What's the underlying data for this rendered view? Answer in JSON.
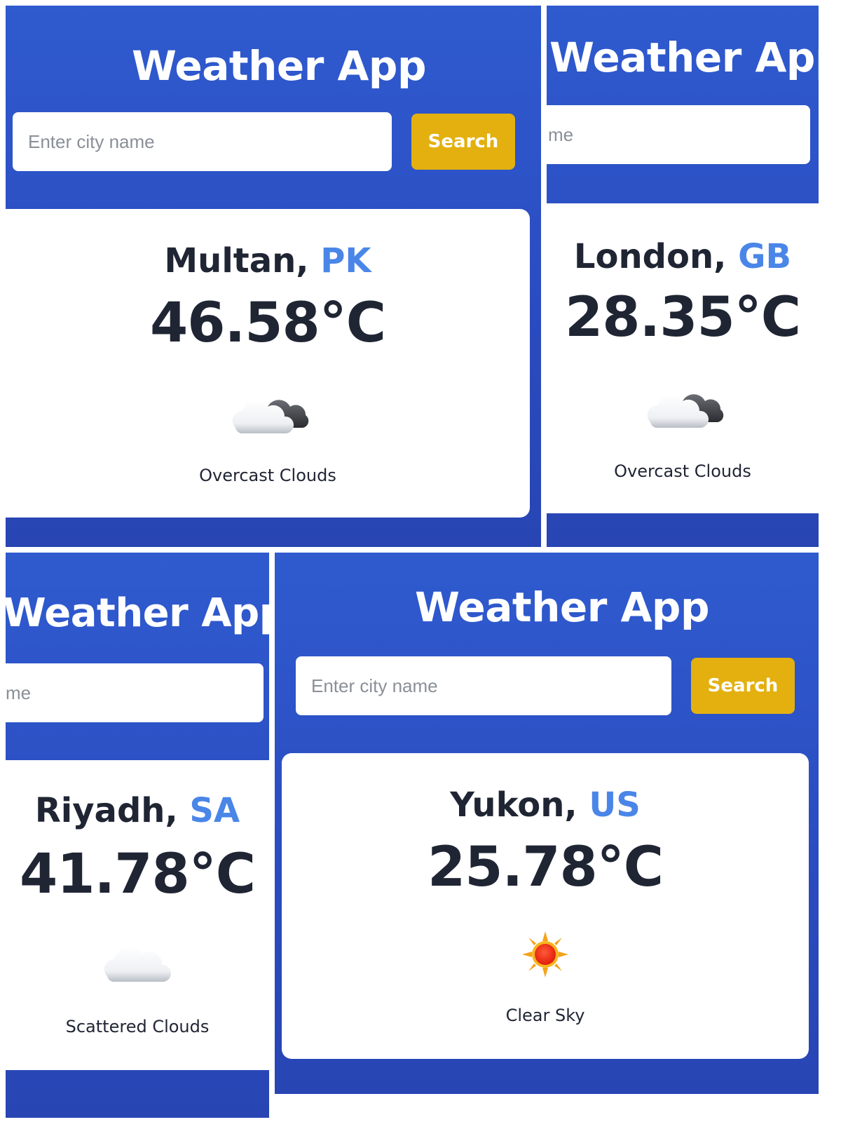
{
  "app_title": "Weather App",
  "search": {
    "placeholder": "Enter city name",
    "placeholder_cropped": "me",
    "button_label": "Search"
  },
  "panels": [
    {
      "city": "Multan",
      "separator": ", ",
      "country": "PK",
      "temp": "46.58°C",
      "description": "Overcast Clouds",
      "icon": "overcast-clouds-icon"
    },
    {
      "city": "London",
      "separator": ", ",
      "country": "GB",
      "temp": "28.35°C",
      "description": "Overcast Clouds",
      "icon": "overcast-clouds-icon"
    },
    {
      "city": "Riyadh",
      "separator": ", ",
      "country": "SA",
      "temp": "41.78°C",
      "description": "Scattered Clouds",
      "icon": "scattered-clouds-icon"
    },
    {
      "city": "Yukon",
      "separator": ", ",
      "country": "US",
      "temp": "25.78°C",
      "description": "Clear Sky",
      "icon": "clear-sky-sun-icon"
    }
  ],
  "colors": {
    "panel_blue": "#2f5bcf",
    "button_gold": "#e3b00f",
    "country_blue": "#4a86e8",
    "text_dark": "#1f2533"
  }
}
